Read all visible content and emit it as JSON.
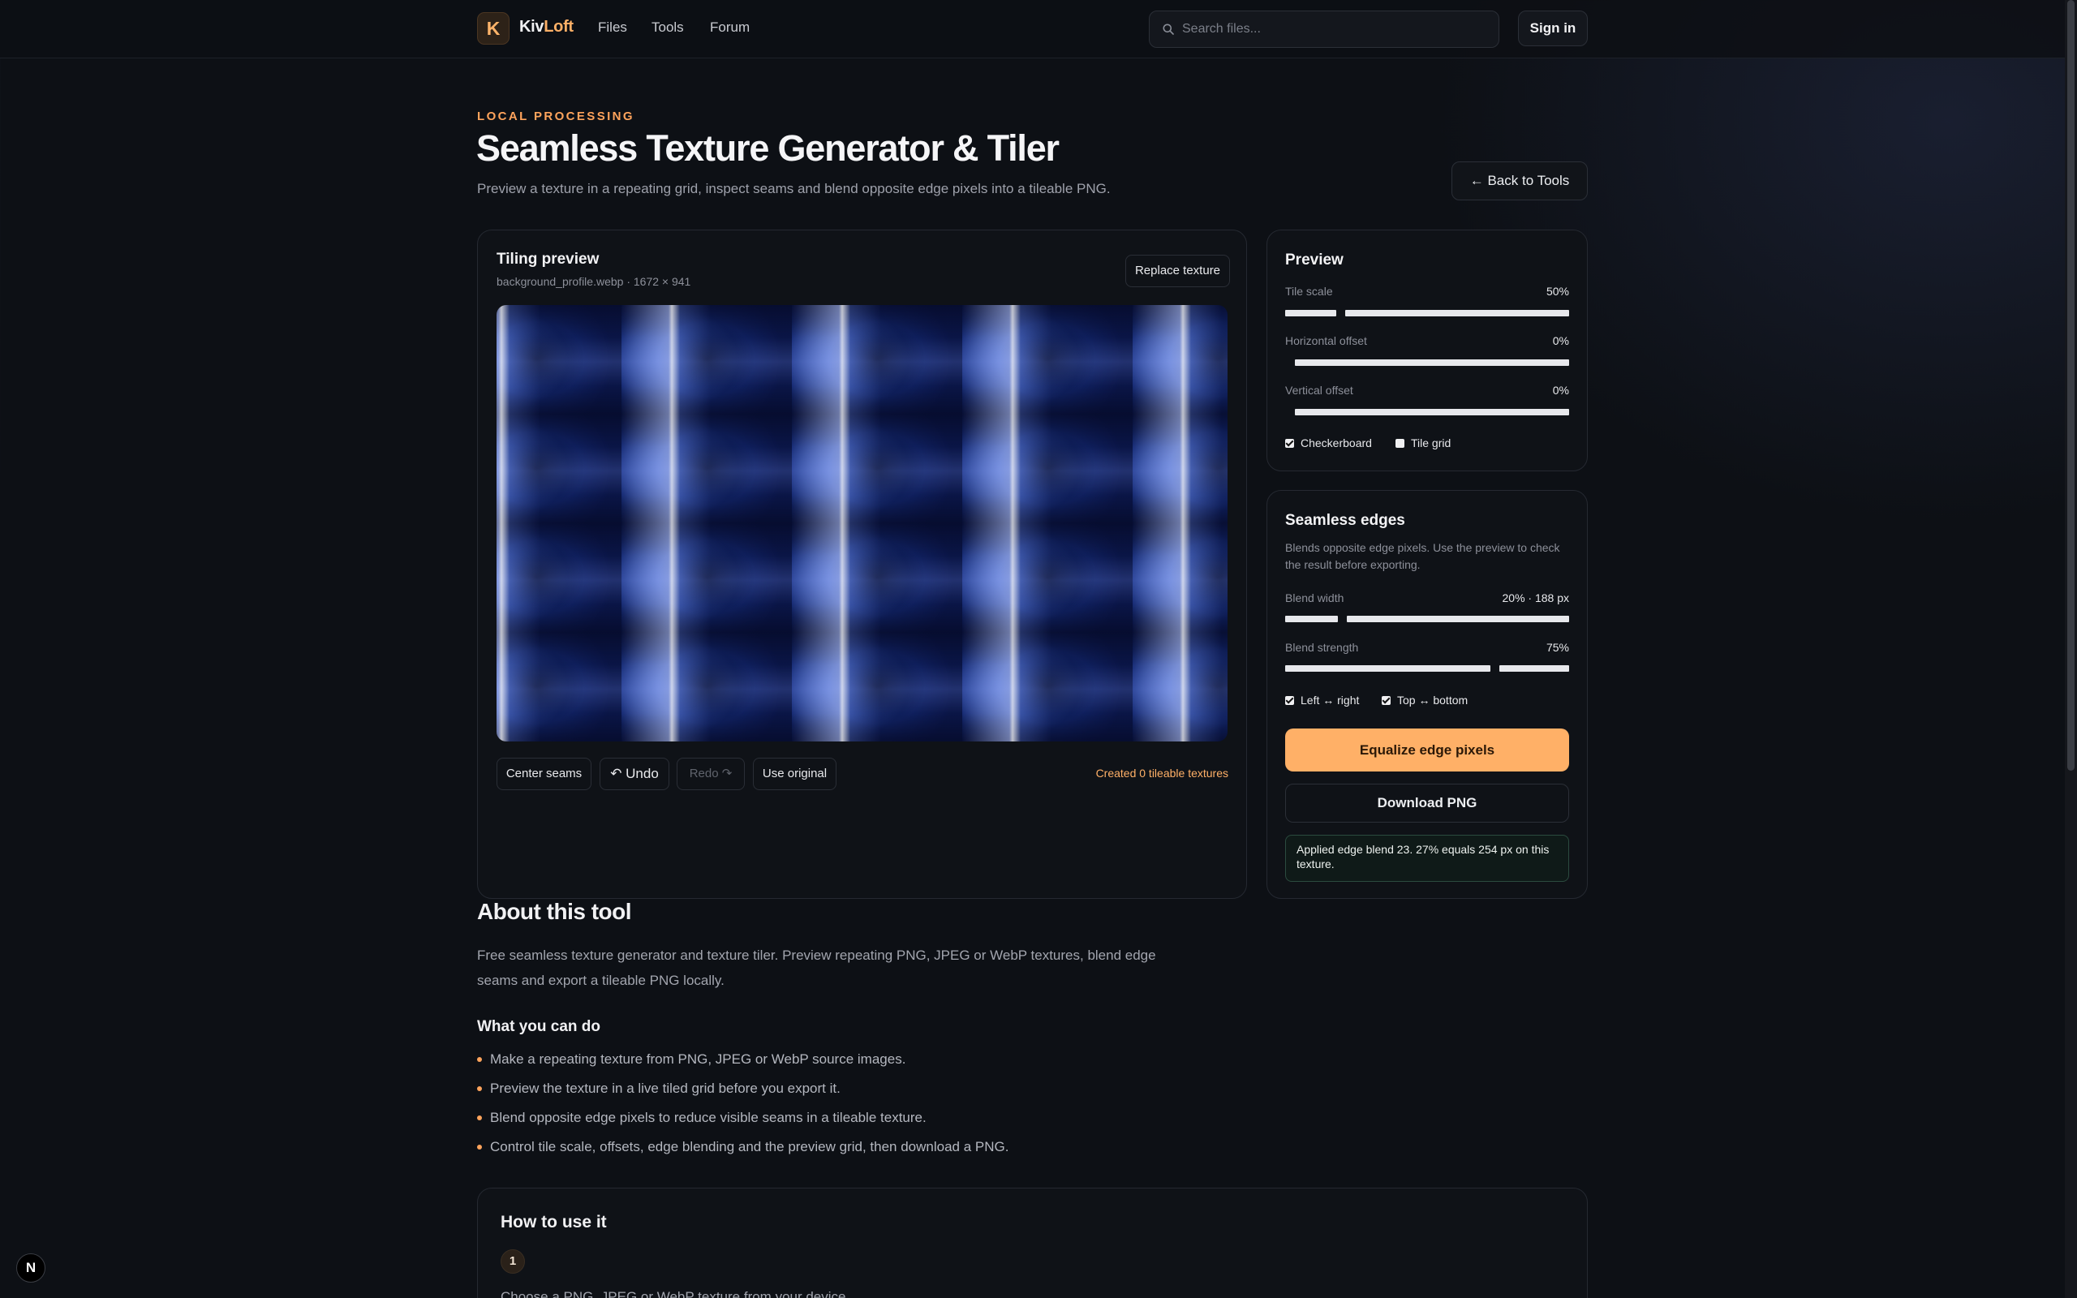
{
  "header": {
    "logo_letter": "K",
    "brand_prefix": "Kiv",
    "brand_suffix": "Loft",
    "nav": [
      "Files",
      "Tools",
      "Forum"
    ],
    "search_placeholder": "Search files...",
    "signin_label": "Sign in"
  },
  "hero": {
    "eyebrow": "LOCAL PROCESSING",
    "title": "Seamless Texture Generator & Tiler",
    "subtitle": "Preview a texture in a repeating grid, inspect seams and blend opposite edge pixels into a tileable PNG.",
    "back_label": "← Back to Tools"
  },
  "tiling": {
    "title": "Tiling preview",
    "file_info": "background_profile.webp · 1672 × 941",
    "replace_label": "Replace texture",
    "center_label": "Center seams",
    "undo_label": "↶ Undo",
    "redo_label": "Redo ↷",
    "original_label": "Use original",
    "status": "Created 0 tileable textures"
  },
  "preview": {
    "title": "Preview",
    "tile_scale_label": "Tile scale",
    "tile_scale_value": "50%",
    "tile_scale_level": 0.18,
    "h_offset_label": "Horizontal offset",
    "h_offset_value": "0%",
    "v_offset_label": "Vertical offset",
    "v_offset_value": "0%",
    "checkerboard_label": "Checkerboard",
    "checkerboard_checked": true,
    "tile_grid_label": "Tile grid",
    "tile_grid_checked": false
  },
  "edges": {
    "title": "Seamless edges",
    "description": "Blends opposite edge pixels. Use the preview to check the result before exporting.",
    "blend_width_label": "Blend width",
    "blend_width_value": "20% · 188 px",
    "blend_width_level": 0.2,
    "blend_strength_label": "Blend strength",
    "blend_strength_value": "75%",
    "blend_strength_level": 0.75,
    "lr_label": "Left ↔ right",
    "lr_checked": true,
    "tb_label": "Top ↔ bottom",
    "tb_checked": true,
    "equalize_label": "Equalize edge pixels",
    "download_label": "Download PNG",
    "notice": "Applied edge blend 23. 27% equals 254 px on this texture."
  },
  "about": {
    "title": "About this tool",
    "text": "Free seamless texture generator and texture tiler. Preview repeating PNG, JPEG or WebP textures, blend edge seams and export a tileable PNG locally.",
    "can_title": "What you can do",
    "items": [
      "Make a repeating texture from PNG, JPEG or WebP source images.",
      "Preview the texture in a live tiled grid before you export it.",
      "Blend opposite edge pixels to reduce visible seams in a tileable texture.",
      "Control tile scale, offsets, edge blending and the preview grid, then download a PNG."
    ]
  },
  "howto": {
    "title": "How to use it",
    "step_number": "1",
    "step_text": "Choose a PNG, JPEG or WebP texture from your device."
  },
  "colors": {
    "accent": "#ffb067",
    "background": "#0d1015"
  },
  "devtools_badge": "N"
}
